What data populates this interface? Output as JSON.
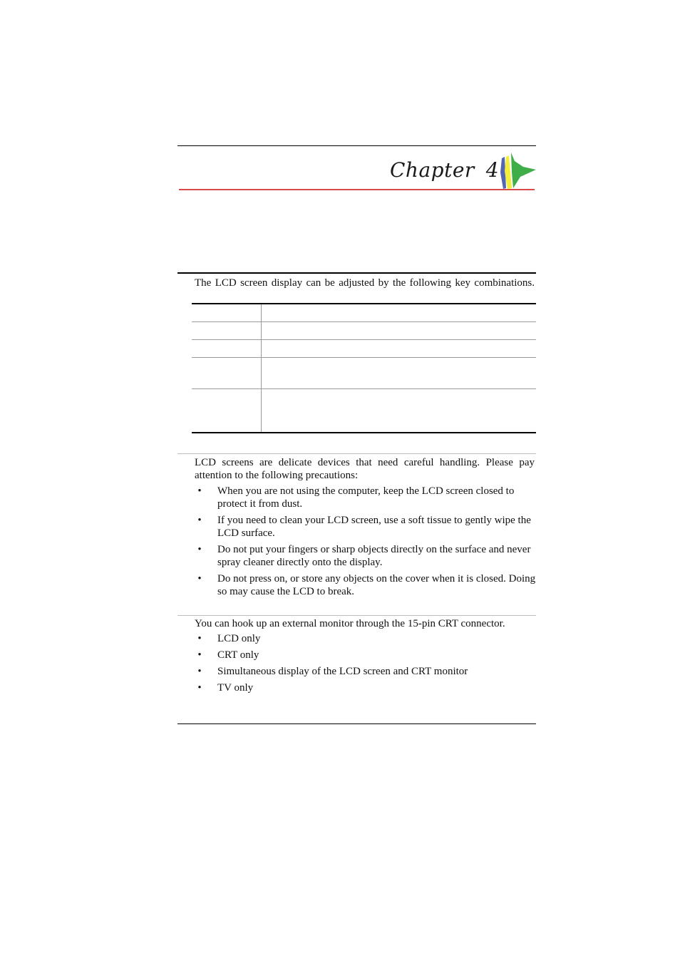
{
  "header": {
    "chapter_word": "Chapter",
    "chapter_number": "4",
    "logo_icon": "tri-color-sail-logo",
    "colors": {
      "accent_red": "#d94a4a",
      "logo_blue": "#5566b0",
      "logo_yellow": "#f2ee3a",
      "logo_green": "#3fae49"
    }
  },
  "section_display": {
    "intro": "The LCD screen display can be adjusted by the following key combinations.",
    "table_rows": [
      {
        "key": "",
        "description": ""
      },
      {
        "key": "",
        "description": ""
      },
      {
        "key": "",
        "description": ""
      },
      {
        "key": "",
        "description": ""
      },
      {
        "key": "",
        "description": ""
      }
    ]
  },
  "section_care": {
    "intro": "LCD screens are delicate devices that need careful handling.  Please pay attention to the following precautions:",
    "bullet_glyph": "•",
    "items": [
      "When you are not using the computer, keep the LCD screen closed to protect it from dust.",
      "If you need to clean your LCD screen, use a soft tissue to gently wipe the LCD surface.",
      "Do not put your fingers or sharp objects directly on the surface and never spray cleaner directly onto the display.",
      "Do not press on, or store any objects on the cover when it is closed.  Doing so may cause the LCD to break."
    ]
  },
  "section_external": {
    "intro": "You can hook up an external monitor through the 15-pin CRT connector.",
    "bullet_glyph": "•",
    "items": [
      "LCD only",
      "CRT only",
      "Simultaneous display of the LCD screen and CRT monitor",
      "TV only"
    ]
  }
}
